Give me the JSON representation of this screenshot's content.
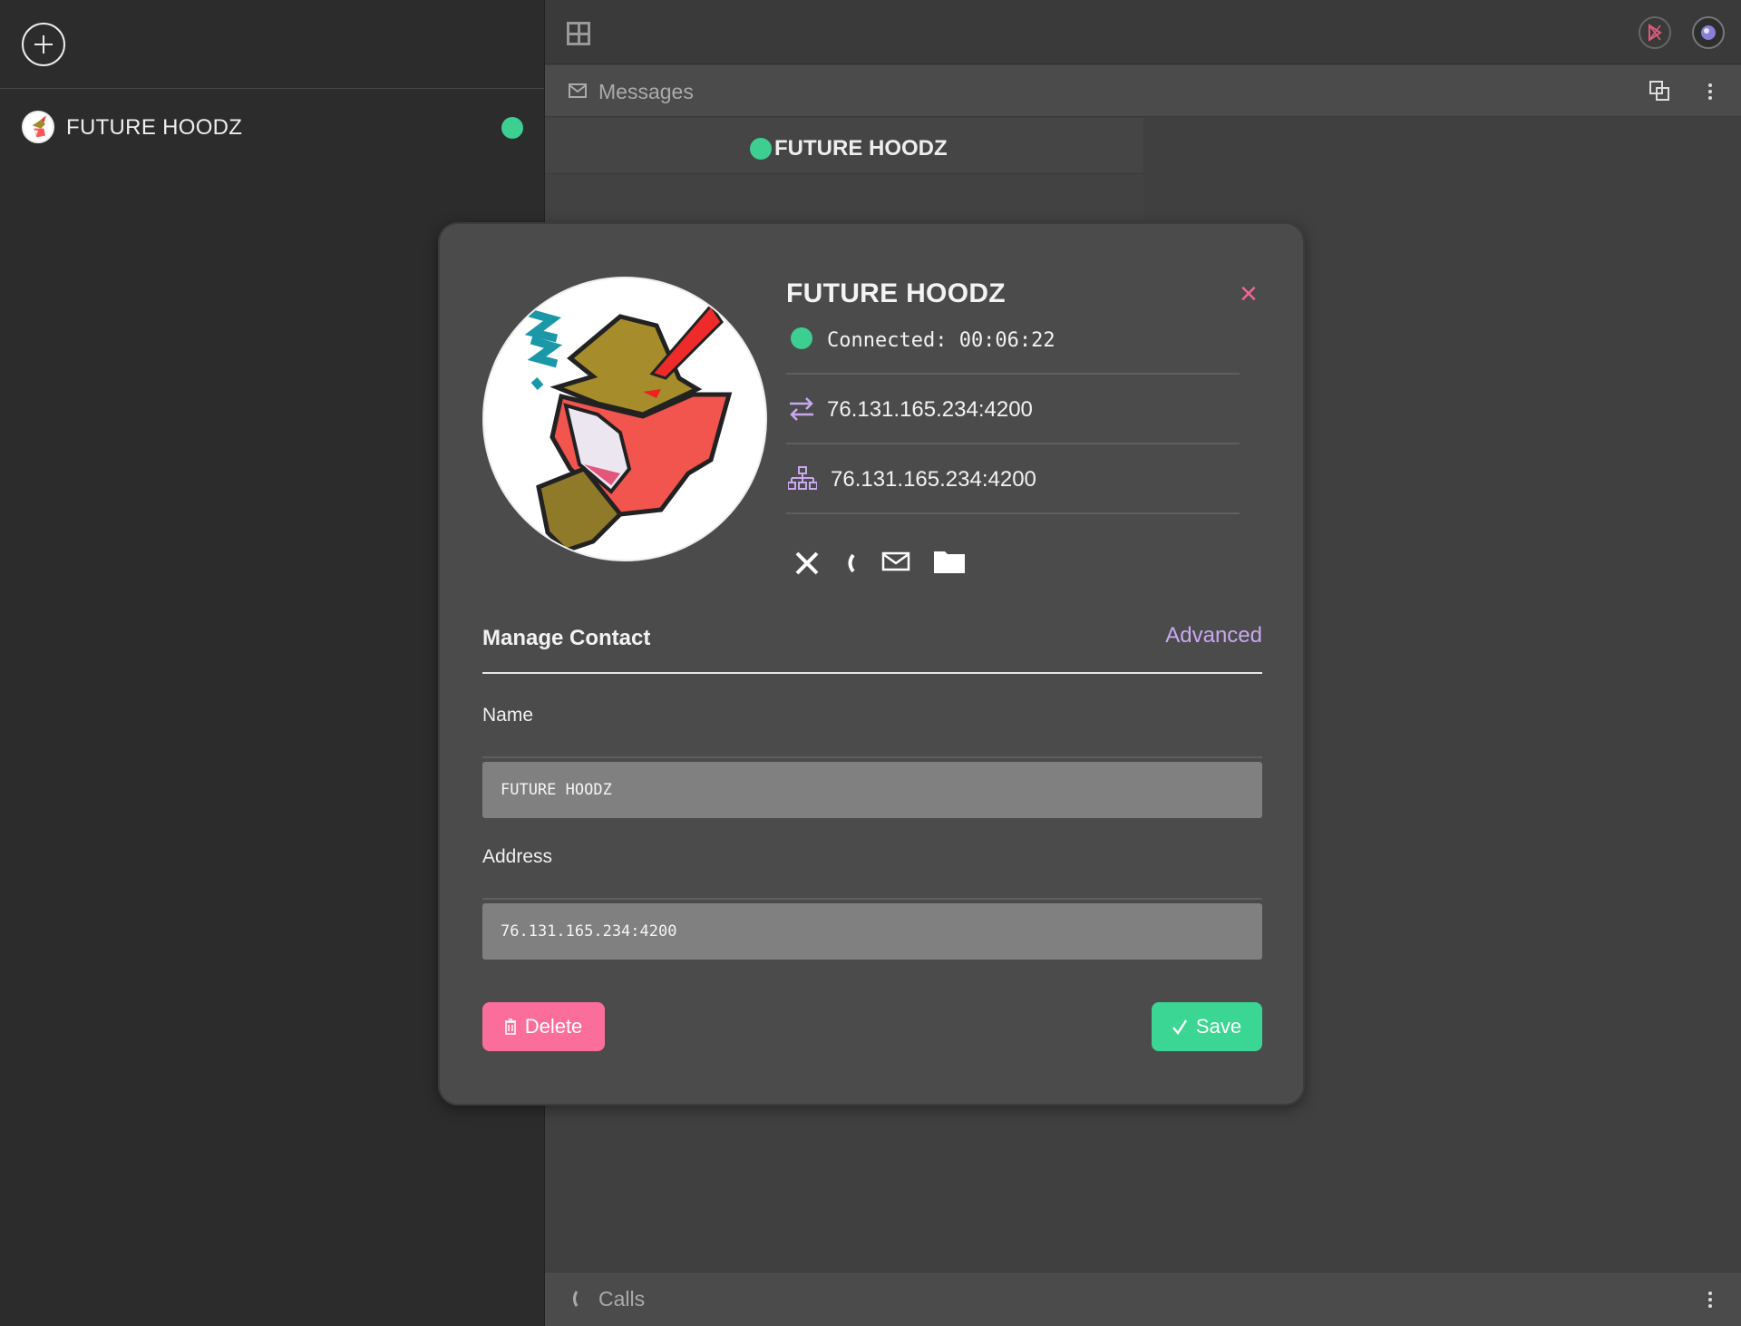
{
  "sidebar": {
    "add_icon": "plus-circle-icon",
    "contacts": [
      {
        "name": "FUTURE HOODZ",
        "status": "online",
        "status_color": "#3ccf91"
      }
    ]
  },
  "topbar": {
    "layout_icon": "grid-icon",
    "app_icons": [
      "app-logo-icon",
      "profile-avatar-icon"
    ]
  },
  "messages_panel": {
    "label": "Messages",
    "icon": "envelope-icon",
    "chat_title": "FUTURE HOODZ"
  },
  "calls_panel": {
    "label": "Calls",
    "icon": "phone-icon"
  },
  "modal": {
    "title": "FUTURE HOODZ",
    "close_label": "×",
    "status_text": "Connected: 00:06:22",
    "status_color": "#3ccf91",
    "address_public": "76.131.165.234:4200",
    "address_local": "76.131.165.234:4200",
    "actions": [
      "disconnect-icon",
      "phone-icon",
      "envelope-icon",
      "folder-icon"
    ],
    "manage_title": "Manage Contact",
    "advanced_label": "Advanced",
    "name_label": "Name",
    "name_value": "FUTURE HOODZ",
    "address_label": "Address",
    "address_value": "76.131.165.234:4200",
    "delete_label": "Delete",
    "save_label": "Save",
    "colors": {
      "accent": "#c9a8f0",
      "danger": "#fb6e9b",
      "success": "#3bd693",
      "close": "#f0679a"
    }
  }
}
